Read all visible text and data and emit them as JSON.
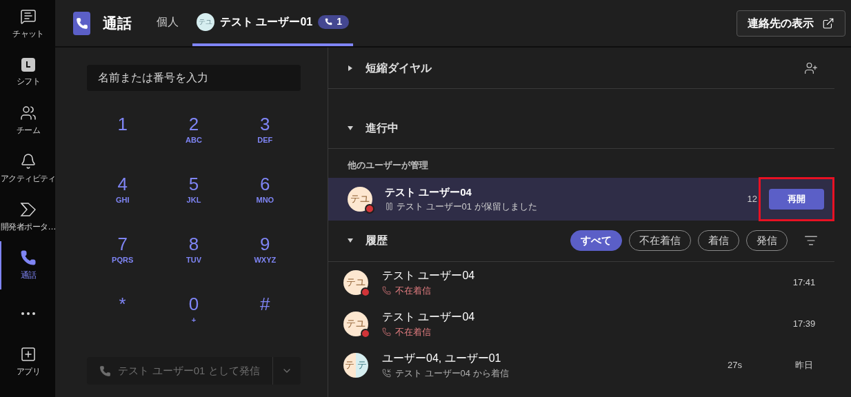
{
  "rail": [
    {
      "label": "チャット",
      "selected": false
    },
    {
      "label": "シフト",
      "selected": false
    },
    {
      "label": "チーム",
      "selected": false
    },
    {
      "label": "アクティビティ",
      "selected": false
    },
    {
      "label": "開発者ポータ…",
      "selected": false
    },
    {
      "label": "通話",
      "selected": true
    },
    {
      "selected": false
    },
    {
      "label": "アプリ",
      "selected": false
    }
  ],
  "header": {
    "title": "通話",
    "tabs": [
      {
        "label": "個人",
        "selected": false
      },
      {
        "label": "テスト ユーザー01",
        "avatar": "テユ",
        "badge": "1",
        "selected": true
      }
    ],
    "contacts_button": "連絡先の表示"
  },
  "dialpad": {
    "placeholder": "名前または番号を入力",
    "keys": [
      {
        "digit": "1"
      },
      {
        "digit": "2",
        "letters": "ABC"
      },
      {
        "digit": "3",
        "letters": "DEF"
      },
      {
        "digit": "4",
        "letters": "GHI"
      },
      {
        "digit": "5",
        "letters": "JKL"
      },
      {
        "digit": "6",
        "letters": "MNO"
      },
      {
        "digit": "7",
        "letters": "PQRS"
      },
      {
        "digit": "8",
        "letters": "TUV"
      },
      {
        "digit": "9",
        "letters": "WXYZ"
      },
      {
        "digit": "*"
      },
      {
        "digit": "0",
        "letters": "+"
      },
      {
        "digit": "#"
      }
    ],
    "call_button": {
      "label": "テスト ユーザー01 として発信",
      "disabled": true
    }
  },
  "speed_dial": {
    "title": "短縮ダイヤル",
    "expanded": false
  },
  "in_progress": {
    "title": "進行中",
    "expanded": true,
    "group_label": "他のユーザーが管理",
    "calls": [
      {
        "name": "テスト ユーザー04",
        "avatar": [
          {
            "initials": "テユ",
            "color": "#fde7d0"
          }
        ],
        "busy": true,
        "status": "テスト ユーザー01 が保留しました",
        "duration": "12",
        "action": "再開",
        "highlighted": true
      }
    ]
  },
  "history": {
    "title": "履歴",
    "expanded": true,
    "filters": [
      {
        "label": "すべて",
        "selected": true
      },
      {
        "label": "不在着信",
        "selected": false
      },
      {
        "label": "着信",
        "selected": false
      },
      {
        "label": "発信",
        "selected": false
      }
    ],
    "rows": [
      {
        "name": "テスト ユーザー04",
        "avatar": [
          {
            "initials": "テユ",
            "color": "#fde7d0"
          }
        ],
        "busy": true,
        "kind": "missed",
        "detail": "不在着信",
        "time": "17:41"
      },
      {
        "name": "テスト ユーザー04",
        "avatar": [
          {
            "initials": "テユ",
            "color": "#fde7d0"
          }
        ],
        "busy": true,
        "kind": "missed",
        "detail": "不在着信",
        "time": "17:39"
      },
      {
        "name": "ユーザー04, ユーザー01",
        "avatar": [
          {
            "initials": "テ",
            "color": "#fde7d0"
          },
          {
            "initials": "テ",
            "color": "#d6eef0"
          }
        ],
        "busy": false,
        "kind": "incoming",
        "detail": "テスト ユーザー04 から着信",
        "duration": "27s",
        "time": "昨日"
      }
    ]
  }
}
